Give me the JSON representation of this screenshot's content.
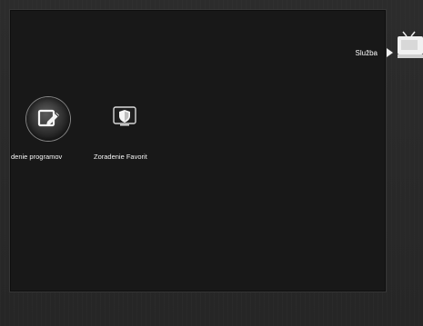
{
  "header": {
    "section_title": "Služba"
  },
  "main": {
    "items": [
      {
        "label": "denie programov",
        "icon": "edit-icon",
        "selected": true
      },
      {
        "label": "Zoradenie Favorit",
        "icon": "shield-favorites-icon",
        "selected": false
      }
    ]
  },
  "icons": {
    "top_right": "tv-icon",
    "pointer": "right-arrow-icon"
  },
  "colors": {
    "background": "#262626",
    "panel": "#181818",
    "text": "#f2f2f2",
    "highlight": "#858585"
  }
}
